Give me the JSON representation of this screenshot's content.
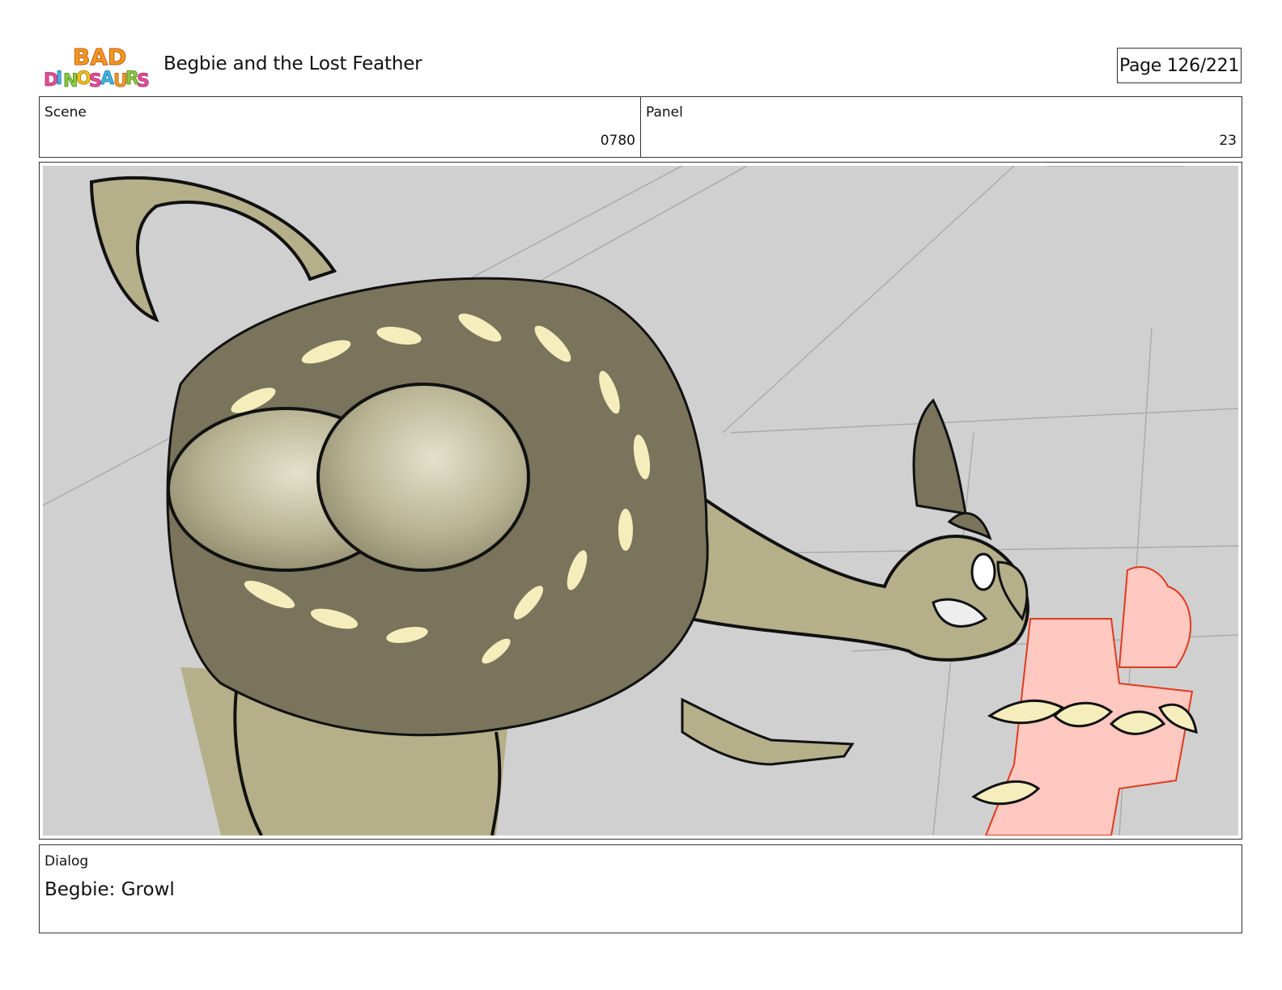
{
  "header": {
    "logo_text": "BAD DINOSAURS",
    "title": "Begbie and the Lost Feather",
    "page": "Page 126/221"
  },
  "scene": {
    "label": "Scene",
    "value": "0780"
  },
  "panel": {
    "label": "Panel",
    "value": "23"
  },
  "dialog": {
    "label": "Dialog",
    "text": "Begbie: Growl"
  },
  "colors": {
    "background_grey": "#d0d0d0",
    "dino_body": "#b5b08a",
    "feathers_dark": "#7a745c",
    "highlight": "#f5eebc",
    "red_character": "#ffc8c0",
    "red_line": "#e03a1e"
  }
}
